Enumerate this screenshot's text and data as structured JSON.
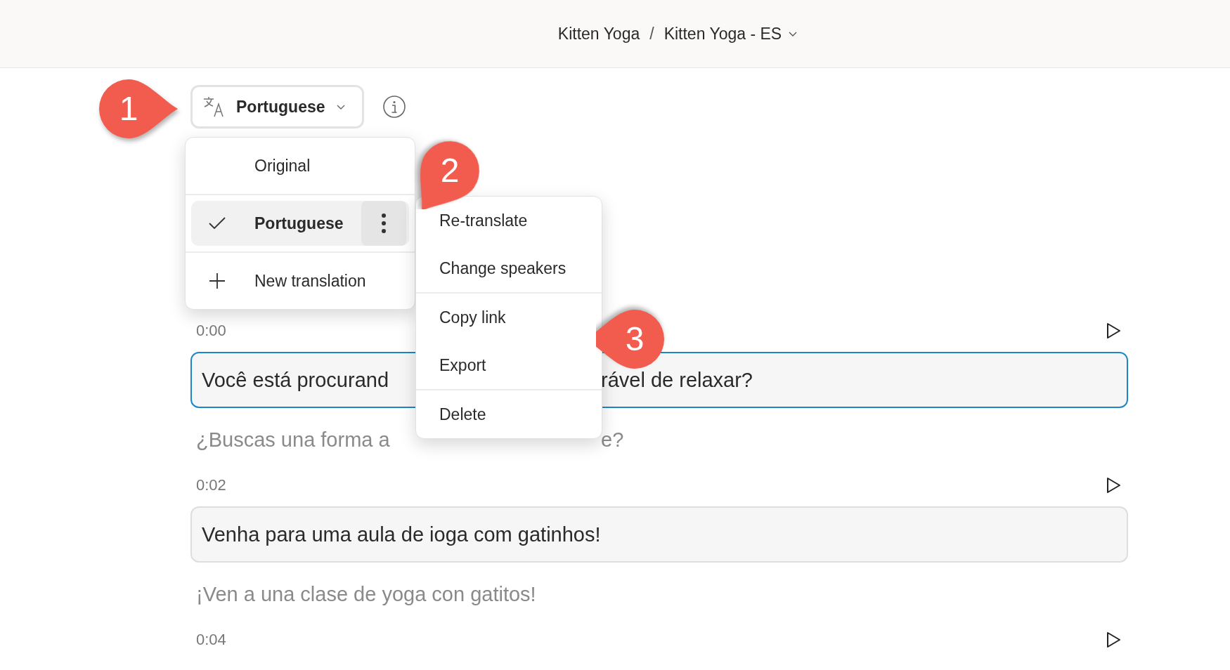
{
  "breadcrumb": {
    "project": "Kitten Yoga",
    "separator": "/",
    "current": "Kitten Yoga - ES"
  },
  "language_button": {
    "label": "Portuguese"
  },
  "language_menu": [
    {
      "kind": "option",
      "label": "Original",
      "selected": false
    },
    {
      "kind": "option",
      "label": "Portuguese",
      "selected": true
    },
    {
      "kind": "add",
      "label": "New translation",
      "selected": false
    }
  ],
  "options_menu": [
    [
      "Re-translate",
      "Change speakers"
    ],
    [
      "Copy link",
      "Export"
    ],
    [
      "Delete"
    ]
  ],
  "segments": [
    {
      "time": "0:00",
      "focused": true,
      "text_parts": [
        "Você está procurand",
        "rável de relaxar?"
      ],
      "source_parts": [
        "¿Buscas una forma a",
        "e?"
      ]
    },
    {
      "time": "0:02",
      "focused": false,
      "text_parts": [
        "Venha para uma aula de ioga com gatinhos!"
      ],
      "source_parts": [
        "¡Ven a una clase de yoga con gatitos!"
      ]
    },
    {
      "time": "0:04"
    }
  ],
  "callouts": [
    {
      "label": "1"
    },
    {
      "label": "2"
    },
    {
      "label": "3"
    }
  ]
}
